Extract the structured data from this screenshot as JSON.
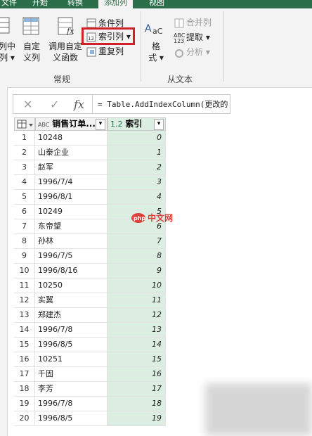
{
  "ribbon_tabs": [
    "文件",
    "开始",
    "转换",
    "添加列",
    "视图"
  ],
  "ribbon": {
    "col_from_example_label": "列中\n列 ▾",
    "custom_column_label": "自定\n义列",
    "invoke_custom_function_label": "调用自定\n义函数",
    "conditional_column_label": "条件列",
    "index_column_label": "索引列",
    "index_column_dropdown": "▾",
    "duplicate_column_label": "重复列",
    "format_label": "格\n式 ▾",
    "merge_columns_label": "合并列",
    "extract_label": "提取 ▾",
    "parse_label": "分析 ▾",
    "group_general": "常规",
    "group_from_text": "从文本",
    "abc_icon_text": "ABC\n123"
  },
  "formula_bar": {
    "cancel_icon": "✕",
    "confirm_icon": "✓",
    "fx_icon": "fx",
    "formula_text": "= Table.AddIndexColumn(更改的"
  },
  "table": {
    "col1_header": "销售订单...",
    "col1_type": "ABC",
    "col2_header": "索引",
    "col2_type": "1.2",
    "filter_arrow": "▾",
    "rows": [
      {
        "n": "1",
        "v": "10248",
        "i": "0"
      },
      {
        "n": "2",
        "v": "山泰企业",
        "i": "1"
      },
      {
        "n": "3",
        "v": "赵军",
        "i": "2"
      },
      {
        "n": "4",
        "v": "1996/7/4",
        "i": "3"
      },
      {
        "n": "5",
        "v": "1996/8/1",
        "i": "4"
      },
      {
        "n": "6",
        "v": "10249",
        "i": "5"
      },
      {
        "n": "7",
        "v": "东帝望",
        "i": "6"
      },
      {
        "n": "8",
        "v": "孙林",
        "i": "7"
      },
      {
        "n": "9",
        "v": "1996/7/5",
        "i": "8"
      },
      {
        "n": "10",
        "v": "1996/8/16",
        "i": "9"
      },
      {
        "n": "11",
        "v": "10250",
        "i": "10"
      },
      {
        "n": "12",
        "v": "实翼",
        "i": "11"
      },
      {
        "n": "13",
        "v": "郑建杰",
        "i": "12"
      },
      {
        "n": "14",
        "v": "1996/7/8",
        "i": "13"
      },
      {
        "n": "15",
        "v": "1996/8/5",
        "i": "14"
      },
      {
        "n": "16",
        "v": "10251",
        "i": "15"
      },
      {
        "n": "17",
        "v": "千固",
        "i": "16"
      },
      {
        "n": "18",
        "v": "李芳",
        "i": "17"
      },
      {
        "n": "19",
        "v": "1996/7/8",
        "i": "18"
      },
      {
        "n": "20",
        "v": "1996/8/5",
        "i": "19"
      }
    ]
  },
  "watermark": "php中文网",
  "colors": {
    "ribbon_green": "#2b6f4a",
    "index_column_fill": "#dbeee1",
    "highlight_red": "#d0202a"
  }
}
